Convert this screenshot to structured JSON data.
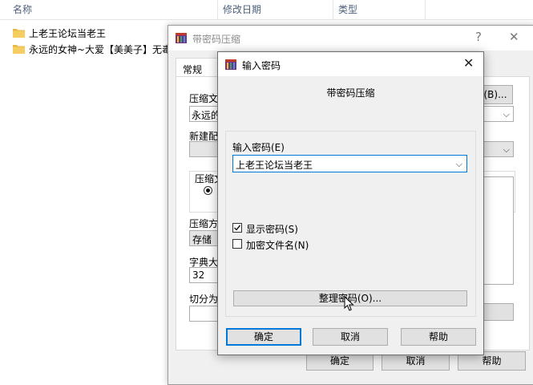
{
  "explorer": {
    "columns": [
      "名称",
      "修改日期",
      "类型"
    ],
    "files": [
      {
        "name": "上老王论坛当老王",
        "icon": "folder-icon"
      },
      {
        "name": "永远的女神~大爱【美美子】无毒",
        "icon": "folder-icon"
      }
    ]
  },
  "back_dialog": {
    "title": "带密码压缩",
    "help_button": "?",
    "close_button": "✕",
    "tab_general": "常规",
    "browse_label": "(B)...",
    "archive_name_label": "压缩文",
    "archive_name_value": "永远的",
    "profile_label": "新建配",
    "format_label": "压缩文",
    "compression_method_label": "压缩方",
    "compression_method_value": "存储",
    "dictionary_label": "字典大",
    "dictionary_value": "32",
    "split_label": "切分为",
    "ok": "确定",
    "cancel": "取消",
    "help": "帮助"
  },
  "password_dialog": {
    "title": "输入密码",
    "close_button": "✕",
    "subtitle": "带密码压缩",
    "password_label": "输入密码(E)",
    "password_value": "上老王论坛当老王",
    "show_password": "显示密码(S)",
    "encrypt_filenames": "加密文件名(N)",
    "organize_button": "整理密码(O)...",
    "ok": "确定",
    "cancel": "取消",
    "help": "帮助"
  },
  "colors": {
    "accent": "#0078d7",
    "dialog_bg": "#f0f0f0",
    "header_text": "#4c607a",
    "folder": "#e8b94a"
  }
}
